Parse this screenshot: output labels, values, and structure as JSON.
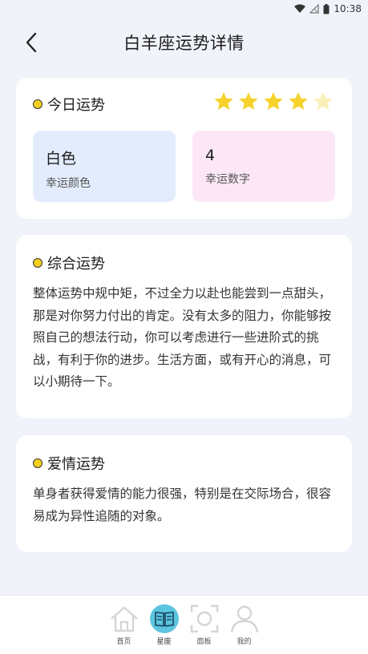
{
  "status_bar": {
    "time": "10:38"
  },
  "header": {
    "title": "白羊座运势详情"
  },
  "today": {
    "title": "今日运势",
    "rating": 4,
    "max_rating": 5,
    "lucky_color": {
      "value": "白色",
      "label": "幸运颜色"
    },
    "lucky_number": {
      "value": "4",
      "label": "幸运数字"
    }
  },
  "general": {
    "title": "综合运势",
    "text": "整体运势中规中矩，不过全力以赴也能尝到一点甜头，那是对你努力付出的肯定。没有太多的阻力，你能够按照自己的想法行动，你可以考虑进行一些进阶式的挑战，有利于你的进步。生活方面，或有开心的消息，可以小期待一下。"
  },
  "love": {
    "title": "爱情运势",
    "text": "单身者获得爱情的能力很强，特别是在交际场合，很容易成为异性追随的对象。"
  },
  "nav": {
    "items": [
      {
        "label": "首页",
        "icon": "home-icon"
      },
      {
        "label": "星座",
        "icon": "book-icon"
      },
      {
        "label": "面板",
        "icon": "scan-icon"
      },
      {
        "label": "我的",
        "icon": "user-icon"
      }
    ],
    "active": "星座"
  },
  "colors": {
    "background": "#f1f3fb",
    "star_filled": "#f6d22b",
    "star_empty": "#fbefb8",
    "dot": "#f5cf1f",
    "lucky_color_tile": "#e3ecfd",
    "lucky_number_tile": "#fde7f6",
    "nav_active": "#5cc5e0"
  }
}
